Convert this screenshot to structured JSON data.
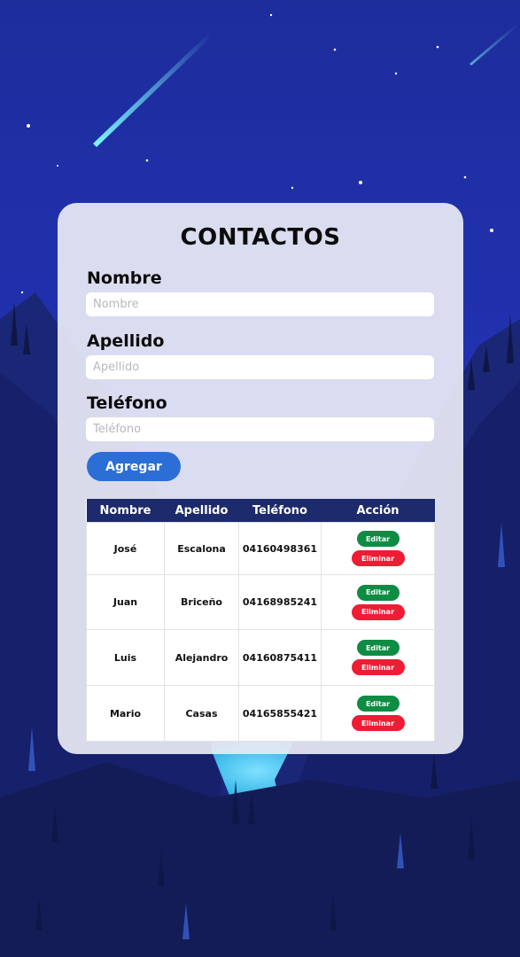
{
  "title": "CONTACTOS",
  "form": {
    "nombre": {
      "label": "Nombre",
      "placeholder": "Nombre",
      "value": ""
    },
    "apellido": {
      "label": "Apellido",
      "placeholder": "Apellido",
      "value": ""
    },
    "telefono": {
      "label": "Teléfono",
      "placeholder": "Teléfono",
      "value": ""
    },
    "add_label": "Agregar"
  },
  "table": {
    "headers": [
      "Nombre",
      "Apellido",
      "Teléfono",
      "Acción"
    ],
    "rows": [
      {
        "nombre": "José",
        "apellido": "Escalona",
        "telefono": "04160498361"
      },
      {
        "nombre": "Juan",
        "apellido": "Briceño",
        "telefono": "04168985241"
      },
      {
        "nombre": "Luis",
        "apellido": "Alejandro",
        "telefono": "04160875411"
      },
      {
        "nombre": "Mario",
        "apellido": "Casas",
        "telefono": "04165855421"
      }
    ],
    "edit_label": "Editar",
    "delete_label": "Eliminar"
  },
  "colors": {
    "accent": "#2b6fd6",
    "header_bg": "#1d2a6b",
    "edit": "#0e8c43",
    "delete": "#ee1c34",
    "sky_top": "#1f2f9e",
    "sky_bottom": "#1a2260"
  }
}
